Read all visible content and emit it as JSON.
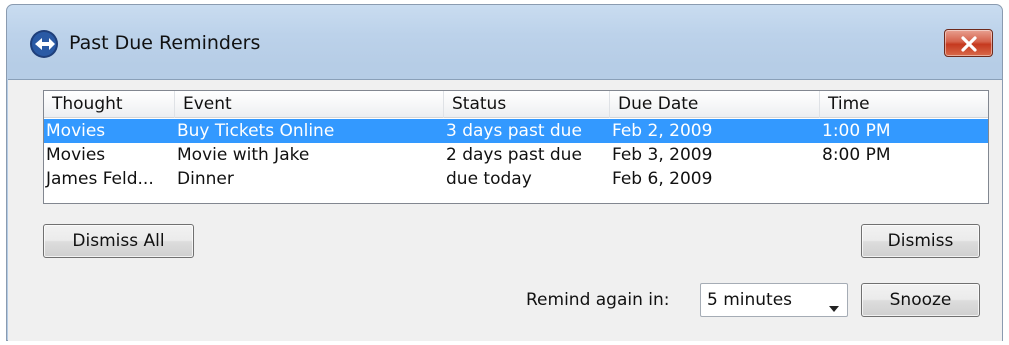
{
  "window": {
    "title": "Past Due Reminders"
  },
  "table": {
    "columns": [
      "Thought",
      "Event",
      "Status",
      "Due Date",
      "Time"
    ],
    "rows": [
      {
        "thought": "Movies",
        "event": "Buy Tickets Online",
        "status": "3 days past due",
        "due_date": "Feb 2, 2009",
        "time": "1:00 PM",
        "selected": true
      },
      {
        "thought": "Movies",
        "event": "Movie with Jake",
        "status": "2 days past due",
        "due_date": "Feb 3, 2009",
        "time": "8:00 PM",
        "selected": false
      },
      {
        "thought": "James Feld...",
        "event": "Dinner",
        "status": "due today",
        "due_date": "Feb 6, 2009",
        "time": "",
        "selected": false
      }
    ]
  },
  "buttons": {
    "dismiss_all": "Dismiss All",
    "dismiss": "Dismiss",
    "snooze": "Snooze"
  },
  "remind": {
    "label": "Remind again in:",
    "selected": "5 minutes"
  },
  "colors": {
    "selection": "#3399ff",
    "close_button": "#c5391f",
    "titlebar": "#bcd2ea"
  }
}
